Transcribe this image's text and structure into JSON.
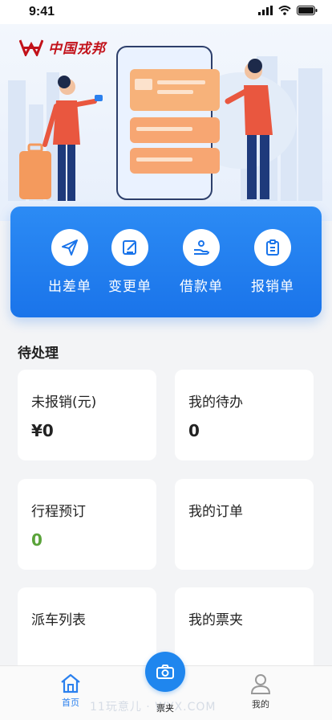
{
  "status_bar": {
    "time": "9:41"
  },
  "brand": {
    "name": "中国戎邦"
  },
  "actions": [
    {
      "label": "出差单",
      "icon": "paper-plane-icon"
    },
    {
      "label": "变更单",
      "icon": "edit-icon"
    },
    {
      "label": "借款单",
      "icon": "loan-icon"
    },
    {
      "label": "报销单",
      "icon": "clipboard-icon"
    }
  ],
  "pending": {
    "title": "待处理",
    "cards": [
      {
        "title": "未报销(元)",
        "value": "¥0"
      },
      {
        "title": "我的待办",
        "value": "0"
      },
      {
        "title": "行程预订",
        "value": "0"
      },
      {
        "title": "我的订单",
        "value": ""
      },
      {
        "title": "派车列表",
        "value": ""
      },
      {
        "title": "我的票夹",
        "value": ""
      }
    ]
  },
  "tabbar": {
    "items": [
      {
        "label": "首页",
        "icon": "home-icon",
        "active": true
      },
      {
        "label": "票夹",
        "icon": "camera-icon",
        "active": false
      },
      {
        "label": "我的",
        "icon": "user-icon",
        "active": false
      }
    ],
    "watermark": "11玩意儿 · WYX.COM"
  },
  "colors": {
    "primary": "#1a74ea",
    "green": "#5aa33a",
    "brand_red": "#c2121a"
  }
}
